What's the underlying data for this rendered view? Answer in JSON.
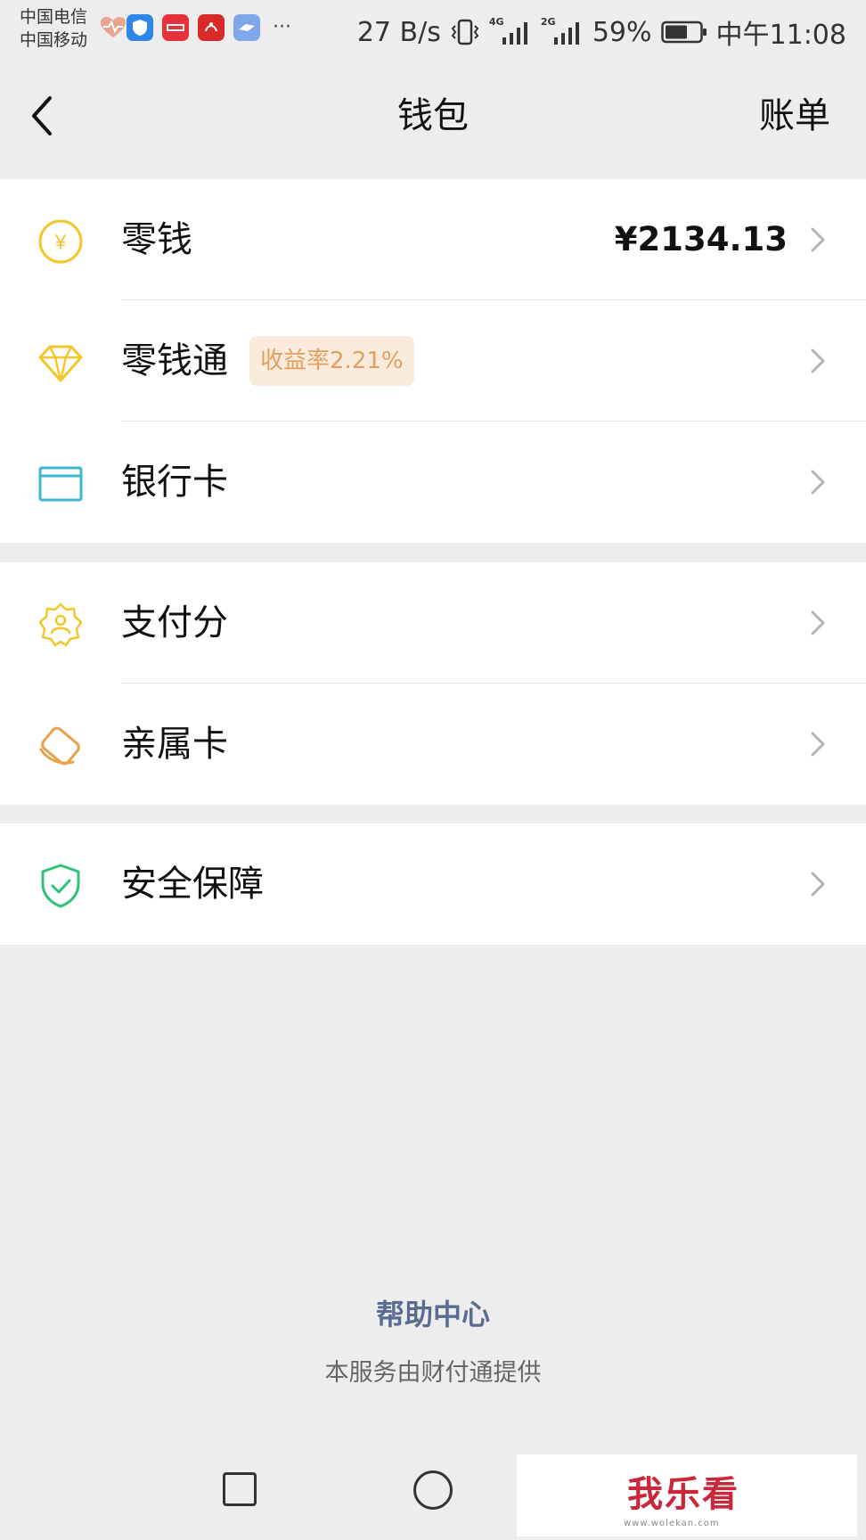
{
  "status_bar": {
    "carriers": [
      "中国电信",
      "中国移动"
    ],
    "net_speed": "27 B/s",
    "sig1": "4G",
    "sig2": "2G",
    "battery": "59%",
    "time": "中午11:08",
    "app_icons": [
      "heart-rate-icon",
      "shield-app-icon",
      "toutiao-app-icon",
      "xuexi-app-icon",
      "cloud-app-icon"
    ],
    "more": "···"
  },
  "nav": {
    "title": "钱包",
    "bill": "账单"
  },
  "groups": [
    {
      "items": [
        {
          "label": "零钱",
          "value": "¥2134.13",
          "icon": "yuan-coin-icon"
        },
        {
          "label": "零钱通",
          "badge": "收益率2.21%",
          "icon": "diamond-icon"
        },
        {
          "label": "银行卡",
          "icon": "bank-card-icon"
        }
      ]
    },
    {
      "items": [
        {
          "label": "支付分",
          "icon": "pay-score-icon"
        },
        {
          "label": "亲属卡",
          "icon": "family-card-icon"
        }
      ]
    },
    {
      "items": [
        {
          "label": "安全保障",
          "icon": "security-shield-icon"
        }
      ]
    }
  ],
  "footer": {
    "help": "帮助中心",
    "provider": "本服务由财付通提供"
  },
  "watermark": {
    "text": "我乐看",
    "url": "www.wolekan.com"
  },
  "colors": {
    "page_bg": "#EDEDED",
    "yellow_icon": "#F3C62B",
    "teal_icon": "#3FB6D1",
    "orange_icon": "#E8A24A",
    "green_icon": "#2CC277",
    "badge_bg": "#FBEBDD",
    "badge_text": "#E2A060",
    "help_link": "#5A6C8F"
  }
}
